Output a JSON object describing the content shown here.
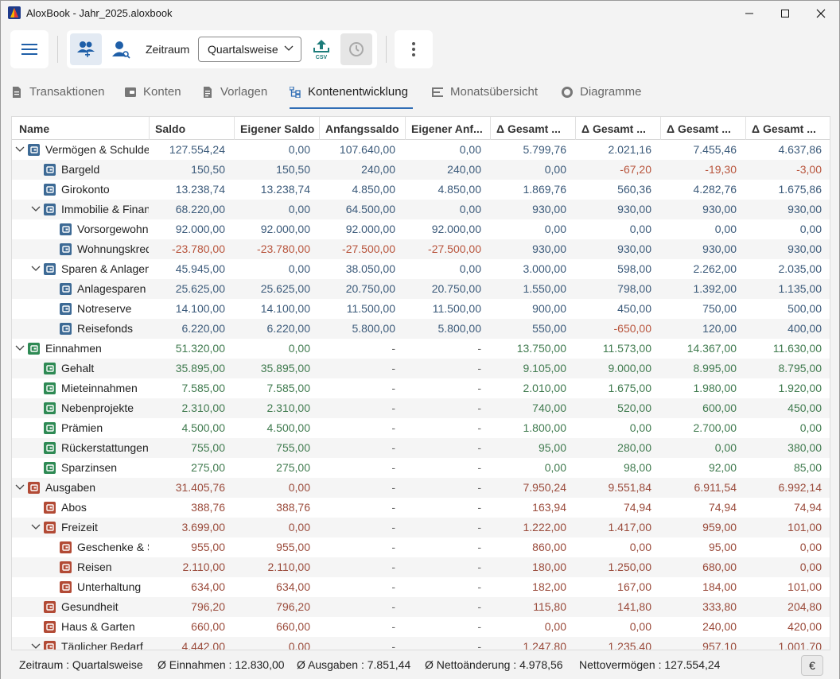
{
  "window": {
    "title": "AloxBook - Jahr_2025.aloxbook"
  },
  "toolbar": {
    "zeitraum_label": "Zeitraum",
    "zeitraum_value": "Quartalsweise",
    "csv_label": "CSV"
  },
  "tabs": [
    {
      "label": "Transaktionen",
      "icon": "document-icon"
    },
    {
      "label": "Konten",
      "icon": "wallet-icon"
    },
    {
      "label": "Vorlagen",
      "icon": "template-icon"
    },
    {
      "label": "Kontenentwicklung",
      "icon": "tree-icon",
      "active": true
    },
    {
      "label": "Monatsübersicht",
      "icon": "list-icon"
    },
    {
      "label": "Diagramme",
      "icon": "donut-icon"
    }
  ],
  "table": {
    "headers": [
      "Name",
      "Saldo",
      "Eigener Saldo",
      "Anfangssaldo",
      "Eigener Anf...",
      "Δ Gesamt ...",
      "Δ Gesamt ...",
      "Δ Gesamt ...",
      "Δ Gesamt ..."
    ],
    "rows": [
      {
        "level": 0,
        "expandable": true,
        "type": "asset",
        "name": "Vermögen & Schulden",
        "values": [
          "127.554,24",
          "0,00",
          "107.640,00",
          "0,00",
          "5.799,76",
          "2.021,16",
          "7.455,46",
          "4.637,86"
        ]
      },
      {
        "level": 1,
        "expandable": false,
        "type": "asset",
        "name": "Bargeld",
        "values": [
          "150,50",
          "150,50",
          "240,00",
          "240,00",
          "0,00",
          "-67,20",
          "-19,30",
          "-3,00"
        ]
      },
      {
        "level": 1,
        "expandable": false,
        "type": "asset",
        "name": "Girokonto",
        "values": [
          "13.238,74",
          "13.238,74",
          "4.850,00",
          "4.850,00",
          "1.869,76",
          "560,36",
          "4.282,76",
          "1.675,86"
        ]
      },
      {
        "level": 1,
        "expandable": true,
        "type": "asset",
        "name": "Immobilie & Finanzierung",
        "values": [
          "68.220,00",
          "0,00",
          "64.500,00",
          "0,00",
          "930,00",
          "930,00",
          "930,00",
          "930,00"
        ]
      },
      {
        "level": 2,
        "expandable": false,
        "type": "asset",
        "name": "Vorsorgewohnung",
        "values": [
          "92.000,00",
          "92.000,00",
          "92.000,00",
          "92.000,00",
          "0,00",
          "0,00",
          "0,00",
          "0,00"
        ]
      },
      {
        "level": 2,
        "expandable": false,
        "type": "asset",
        "name": "Wohnungskredit",
        "values": [
          "-23.780,00",
          "-23.780,00",
          "-27.500,00",
          "-27.500,00",
          "930,00",
          "930,00",
          "930,00",
          "930,00"
        ]
      },
      {
        "level": 1,
        "expandable": true,
        "type": "asset",
        "name": "Sparen & Anlagen",
        "values": [
          "45.945,00",
          "0,00",
          "38.050,00",
          "0,00",
          "3.000,00",
          "598,00",
          "2.262,00",
          "2.035,00"
        ]
      },
      {
        "level": 2,
        "expandable": false,
        "type": "asset",
        "name": "Anlagesparen",
        "values": [
          "25.625,00",
          "25.625,00",
          "20.750,00",
          "20.750,00",
          "1.550,00",
          "798,00",
          "1.392,00",
          "1.135,00"
        ]
      },
      {
        "level": 2,
        "expandable": false,
        "type": "asset",
        "name": "Notreserve",
        "values": [
          "14.100,00",
          "14.100,00",
          "11.500,00",
          "11.500,00",
          "900,00",
          "450,00",
          "750,00",
          "500,00"
        ]
      },
      {
        "level": 2,
        "expandable": false,
        "type": "asset",
        "name": "Reisefonds",
        "values": [
          "6.220,00",
          "6.220,00",
          "5.800,00",
          "5.800,00",
          "550,00",
          "-650,00",
          "120,00",
          "400,00"
        ]
      },
      {
        "level": 0,
        "expandable": true,
        "type": "income",
        "name": "Einnahmen",
        "values": [
          "51.320,00",
          "0,00",
          "-",
          "-",
          "13.750,00",
          "11.573,00",
          "14.367,00",
          "11.630,00"
        ]
      },
      {
        "level": 1,
        "expandable": false,
        "type": "income",
        "name": "Gehalt",
        "values": [
          "35.895,00",
          "35.895,00",
          "-",
          "-",
          "9.105,00",
          "9.000,00",
          "8.995,00",
          "8.795,00"
        ]
      },
      {
        "level": 1,
        "expandable": false,
        "type": "income",
        "name": "Mieteinnahmen",
        "values": [
          "7.585,00",
          "7.585,00",
          "-",
          "-",
          "2.010,00",
          "1.675,00",
          "1.980,00",
          "1.920,00"
        ]
      },
      {
        "level": 1,
        "expandable": false,
        "type": "income",
        "name": "Nebenprojekte",
        "values": [
          "2.310,00",
          "2.310,00",
          "-",
          "-",
          "740,00",
          "520,00",
          "600,00",
          "450,00"
        ]
      },
      {
        "level": 1,
        "expandable": false,
        "type": "income",
        "name": "Prämien",
        "values": [
          "4.500,00",
          "4.500,00",
          "-",
          "-",
          "1.800,00",
          "0,00",
          "2.700,00",
          "0,00"
        ]
      },
      {
        "level": 1,
        "expandable": false,
        "type": "income",
        "name": "Rückerstattungen",
        "values": [
          "755,00",
          "755,00",
          "-",
          "-",
          "95,00",
          "280,00",
          "0,00",
          "380,00"
        ]
      },
      {
        "level": 1,
        "expandable": false,
        "type": "income",
        "name": "Sparzinsen",
        "values": [
          "275,00",
          "275,00",
          "-",
          "-",
          "0,00",
          "98,00",
          "92,00",
          "85,00"
        ]
      },
      {
        "level": 0,
        "expandable": true,
        "type": "expense",
        "name": "Ausgaben",
        "values": [
          "31.405,76",
          "0,00",
          "-",
          "-",
          "7.950,24",
          "9.551,84",
          "6.911,54",
          "6.992,14"
        ]
      },
      {
        "level": 1,
        "expandable": false,
        "type": "expense",
        "name": "Abos",
        "values": [
          "388,76",
          "388,76",
          "-",
          "-",
          "163,94",
          "74,94",
          "74,94",
          "74,94"
        ]
      },
      {
        "level": 1,
        "expandable": true,
        "type": "expense",
        "name": "Freizeit",
        "values": [
          "3.699,00",
          "0,00",
          "-",
          "-",
          "1.222,00",
          "1.417,00",
          "959,00",
          "101,00"
        ]
      },
      {
        "level": 2,
        "expandable": false,
        "type": "expense",
        "name": "Geschenke & Spenden",
        "values": [
          "955,00",
          "955,00",
          "-",
          "-",
          "860,00",
          "0,00",
          "95,00",
          "0,00"
        ]
      },
      {
        "level": 2,
        "expandable": false,
        "type": "expense",
        "name": "Reisen",
        "values": [
          "2.110,00",
          "2.110,00",
          "-",
          "-",
          "180,00",
          "1.250,00",
          "680,00",
          "0,00"
        ]
      },
      {
        "level": 2,
        "expandable": false,
        "type": "expense",
        "name": "Unterhaltung",
        "values": [
          "634,00",
          "634,00",
          "-",
          "-",
          "182,00",
          "167,00",
          "184,00",
          "101,00"
        ]
      },
      {
        "level": 1,
        "expandable": false,
        "type": "expense",
        "name": "Gesundheit",
        "values": [
          "796,20",
          "796,20",
          "-",
          "-",
          "115,80",
          "141,80",
          "333,80",
          "204,80"
        ]
      },
      {
        "level": 1,
        "expandable": false,
        "type": "expense",
        "name": "Haus & Garten",
        "values": [
          "660,00",
          "660,00",
          "-",
          "-",
          "0,00",
          "0,00",
          "240,00",
          "420,00"
        ]
      },
      {
        "level": 1,
        "expandable": true,
        "type": "expense",
        "name": "Täglicher Bedarf",
        "values": [
          "4.442,00",
          "0,00",
          "-",
          "-",
          "1.247,80",
          "1.235,40",
          "957,10",
          "1.001,70"
        ]
      }
    ]
  },
  "statusbar": {
    "zeitraum": "Zeitraum : Quartalsweise",
    "einnahmen": "Ø Einnahmen : 12.830,00",
    "ausgaben": "Ø Ausgaben : 7.851,44",
    "netto": "Ø Nettoänderung : 4.978,56",
    "vermoegen": "Nettovermögen : 127.554,24",
    "currency": "€"
  },
  "colors": {
    "asset_text": "#3b5a7a",
    "asset_neg": "#b8543c",
    "income_text": "#3f7a4e",
    "expense_text": "#9a4a3a",
    "asset_icon": "#3d6a95",
    "income_icon": "#2e8a54",
    "expense_icon": "#b24a35",
    "accent": "#2f6db5"
  }
}
